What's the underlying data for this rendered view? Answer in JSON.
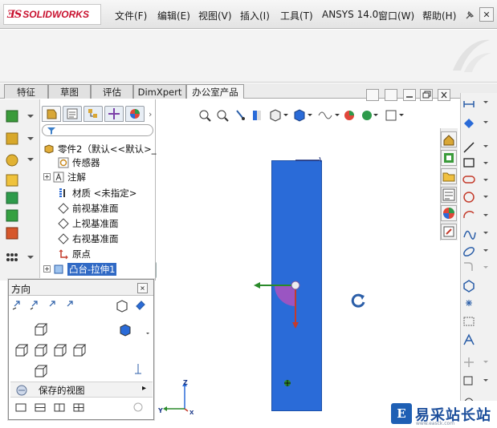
{
  "app": {
    "logo_text": "SOLIDWORKS"
  },
  "menu": {
    "items": [
      {
        "label": "文件(F)"
      },
      {
        "label": "编辑(E)"
      },
      {
        "label": "视图(V)"
      },
      {
        "label": "插入(I)"
      },
      {
        "label": "工具(T)"
      },
      {
        "label": "ANSYS 14.0"
      },
      {
        "label": "窗口(W)"
      },
      {
        "label": "帮助(H)"
      }
    ]
  },
  "command_tabs": [
    {
      "label": "特征"
    },
    {
      "label": "草图"
    },
    {
      "label": "评估"
    },
    {
      "label": "DimXpert"
    },
    {
      "label": "办公室产品"
    }
  ],
  "feature_tree": {
    "root_label": "零件2（默认<<默认>_",
    "items": [
      {
        "label": "传感器",
        "icon": "sensor-icon"
      },
      {
        "label": "注解",
        "icon": "annotations-icon"
      },
      {
        "label": "材质 <未指定>",
        "icon": "material-icon"
      },
      {
        "label": "前视基准面",
        "icon": "plane-icon"
      },
      {
        "label": "上视基准面",
        "icon": "plane-icon"
      },
      {
        "label": "右视基准面",
        "icon": "plane-icon"
      },
      {
        "label": "原点",
        "icon": "origin-icon"
      },
      {
        "label": "凸台-拉伸1",
        "icon": "boss-extrude-icon"
      }
    ]
  },
  "orientation_panel": {
    "title": "方向",
    "close_label": "×",
    "saved_views_label": "保存的视图"
  },
  "triad": {
    "z_label": "Z",
    "y_label": "Y",
    "x_label": "X"
  },
  "watermark": {
    "site_name": "易采站长站",
    "site_sub": "www.easck.com",
    "logo_glyph": "E"
  },
  "colors": {
    "model_blue": "#2a6bd8",
    "selected_row": "#316ac5",
    "brand_red": "#c8102e"
  }
}
